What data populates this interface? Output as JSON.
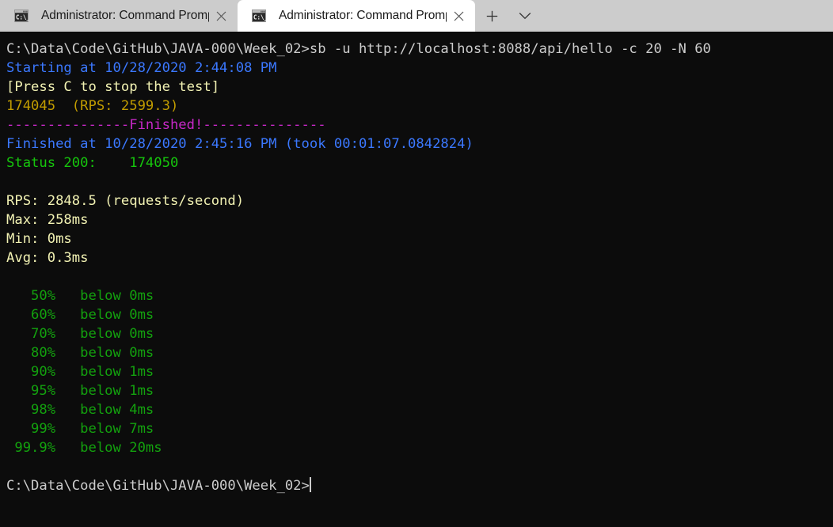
{
  "window": {
    "app": "Windows Terminal",
    "tabbar_bg": "#cccccc",
    "terminal_bg": "#0c0c0c"
  },
  "tabs": [
    {
      "title": "Administrator: Command Promp",
      "icon": "cmd-console-icon",
      "active": false,
      "close_label": "✕"
    },
    {
      "title": "Administrator: Command Promp",
      "icon": "cmd-console-icon",
      "active": true,
      "close_label": "✕"
    }
  ],
  "tabbar_buttons": {
    "new_tab_label": "+",
    "dropdown_label": "∨"
  },
  "terminal": {
    "prompt_path": "C:\\Data\\Code\\GitHub\\JAVA-000\\Week_02>",
    "command": "sb -u http://localhost:8088/api/hello -c 20 -N 60",
    "lines": [
      {
        "id": "command-line",
        "color": "white",
        "text": "C:\\Data\\Code\\GitHub\\JAVA-000\\Week_02>sb -u http://localhost:8088/api/hello -c 20 -N 60"
      },
      {
        "id": "starting-line",
        "color": "blue",
        "text": "Starting at 10/28/2020 2:44:08 PM"
      },
      {
        "id": "hint-line",
        "color": "yellow",
        "text": "[Press C to stop the test]"
      },
      {
        "id": "progress-line",
        "color": "gold",
        "text": "174045  (RPS: 2599.3)"
      },
      {
        "id": "finished-banner",
        "color": "magenta",
        "text": "---------------Finished!---------------"
      },
      {
        "id": "finished-line",
        "color": "blue",
        "text": "Finished at 10/28/2020 2:45:16 PM (took 00:01:07.0842824)"
      },
      {
        "id": "status-line",
        "color": "green",
        "text": "Status 200:    174050"
      },
      {
        "id": "blank-1",
        "color": "white",
        "text": ""
      },
      {
        "id": "rps-line",
        "color": "yellow",
        "text": "RPS: 2848.5 (requests/second)"
      },
      {
        "id": "max-line",
        "color": "yellow",
        "text": "Max: 258ms"
      },
      {
        "id": "min-line",
        "color": "yellow",
        "text": "Min: 0ms"
      },
      {
        "id": "avg-line",
        "color": "yellow",
        "text": "Avg: 0.3ms"
      },
      {
        "id": "blank-2",
        "color": "white",
        "text": ""
      },
      {
        "id": "pct-50",
        "color": "darkgreen",
        "text": "   50%   below 0ms"
      },
      {
        "id": "pct-60",
        "color": "darkgreen",
        "text": "   60%   below 0ms"
      },
      {
        "id": "pct-70",
        "color": "darkgreen",
        "text": "   70%   below 0ms"
      },
      {
        "id": "pct-80",
        "color": "darkgreen",
        "text": "   80%   below 0ms"
      },
      {
        "id": "pct-90",
        "color": "darkgreen",
        "text": "   90%   below 1ms"
      },
      {
        "id": "pct-95",
        "color": "darkgreen",
        "text": "   95%   below 1ms"
      },
      {
        "id": "pct-98",
        "color": "darkgreen",
        "text": "   98%   below 4ms"
      },
      {
        "id": "pct-99",
        "color": "darkgreen",
        "text": "   99%   below 7ms"
      },
      {
        "id": "pct-999",
        "color": "darkgreen",
        "text": " 99.9%   below 20ms"
      },
      {
        "id": "blank-3",
        "color": "white",
        "text": ""
      },
      {
        "id": "final-prompt",
        "color": "white",
        "text": "C:\\Data\\Code\\GitHub\\JAVA-000\\Week_02>",
        "cursor": true
      }
    ],
    "stats": {
      "starting_at": "10/28/2020 2:44:08 PM",
      "finished_at": "10/28/2020 2:45:16 PM",
      "took": "00:01:07.0842824",
      "requests_during_run": "174045",
      "running_rps": "2599.3",
      "status_200_count": "174050",
      "rps": "2848.5",
      "max": "258ms",
      "min": "0ms",
      "avg": "0.3ms"
    },
    "percentiles": [
      {
        "pct": "50%",
        "value": "below 0ms"
      },
      {
        "pct": "60%",
        "value": "below 0ms"
      },
      {
        "pct": "70%",
        "value": "below 0ms"
      },
      {
        "pct": "80%",
        "value": "below 0ms"
      },
      {
        "pct": "90%",
        "value": "below 1ms"
      },
      {
        "pct": "95%",
        "value": "below 1ms"
      },
      {
        "pct": "98%",
        "value": "below 4ms"
      },
      {
        "pct": "99%",
        "value": "below 7ms"
      },
      {
        "pct": "99.9%",
        "value": "below 20ms"
      }
    ]
  }
}
